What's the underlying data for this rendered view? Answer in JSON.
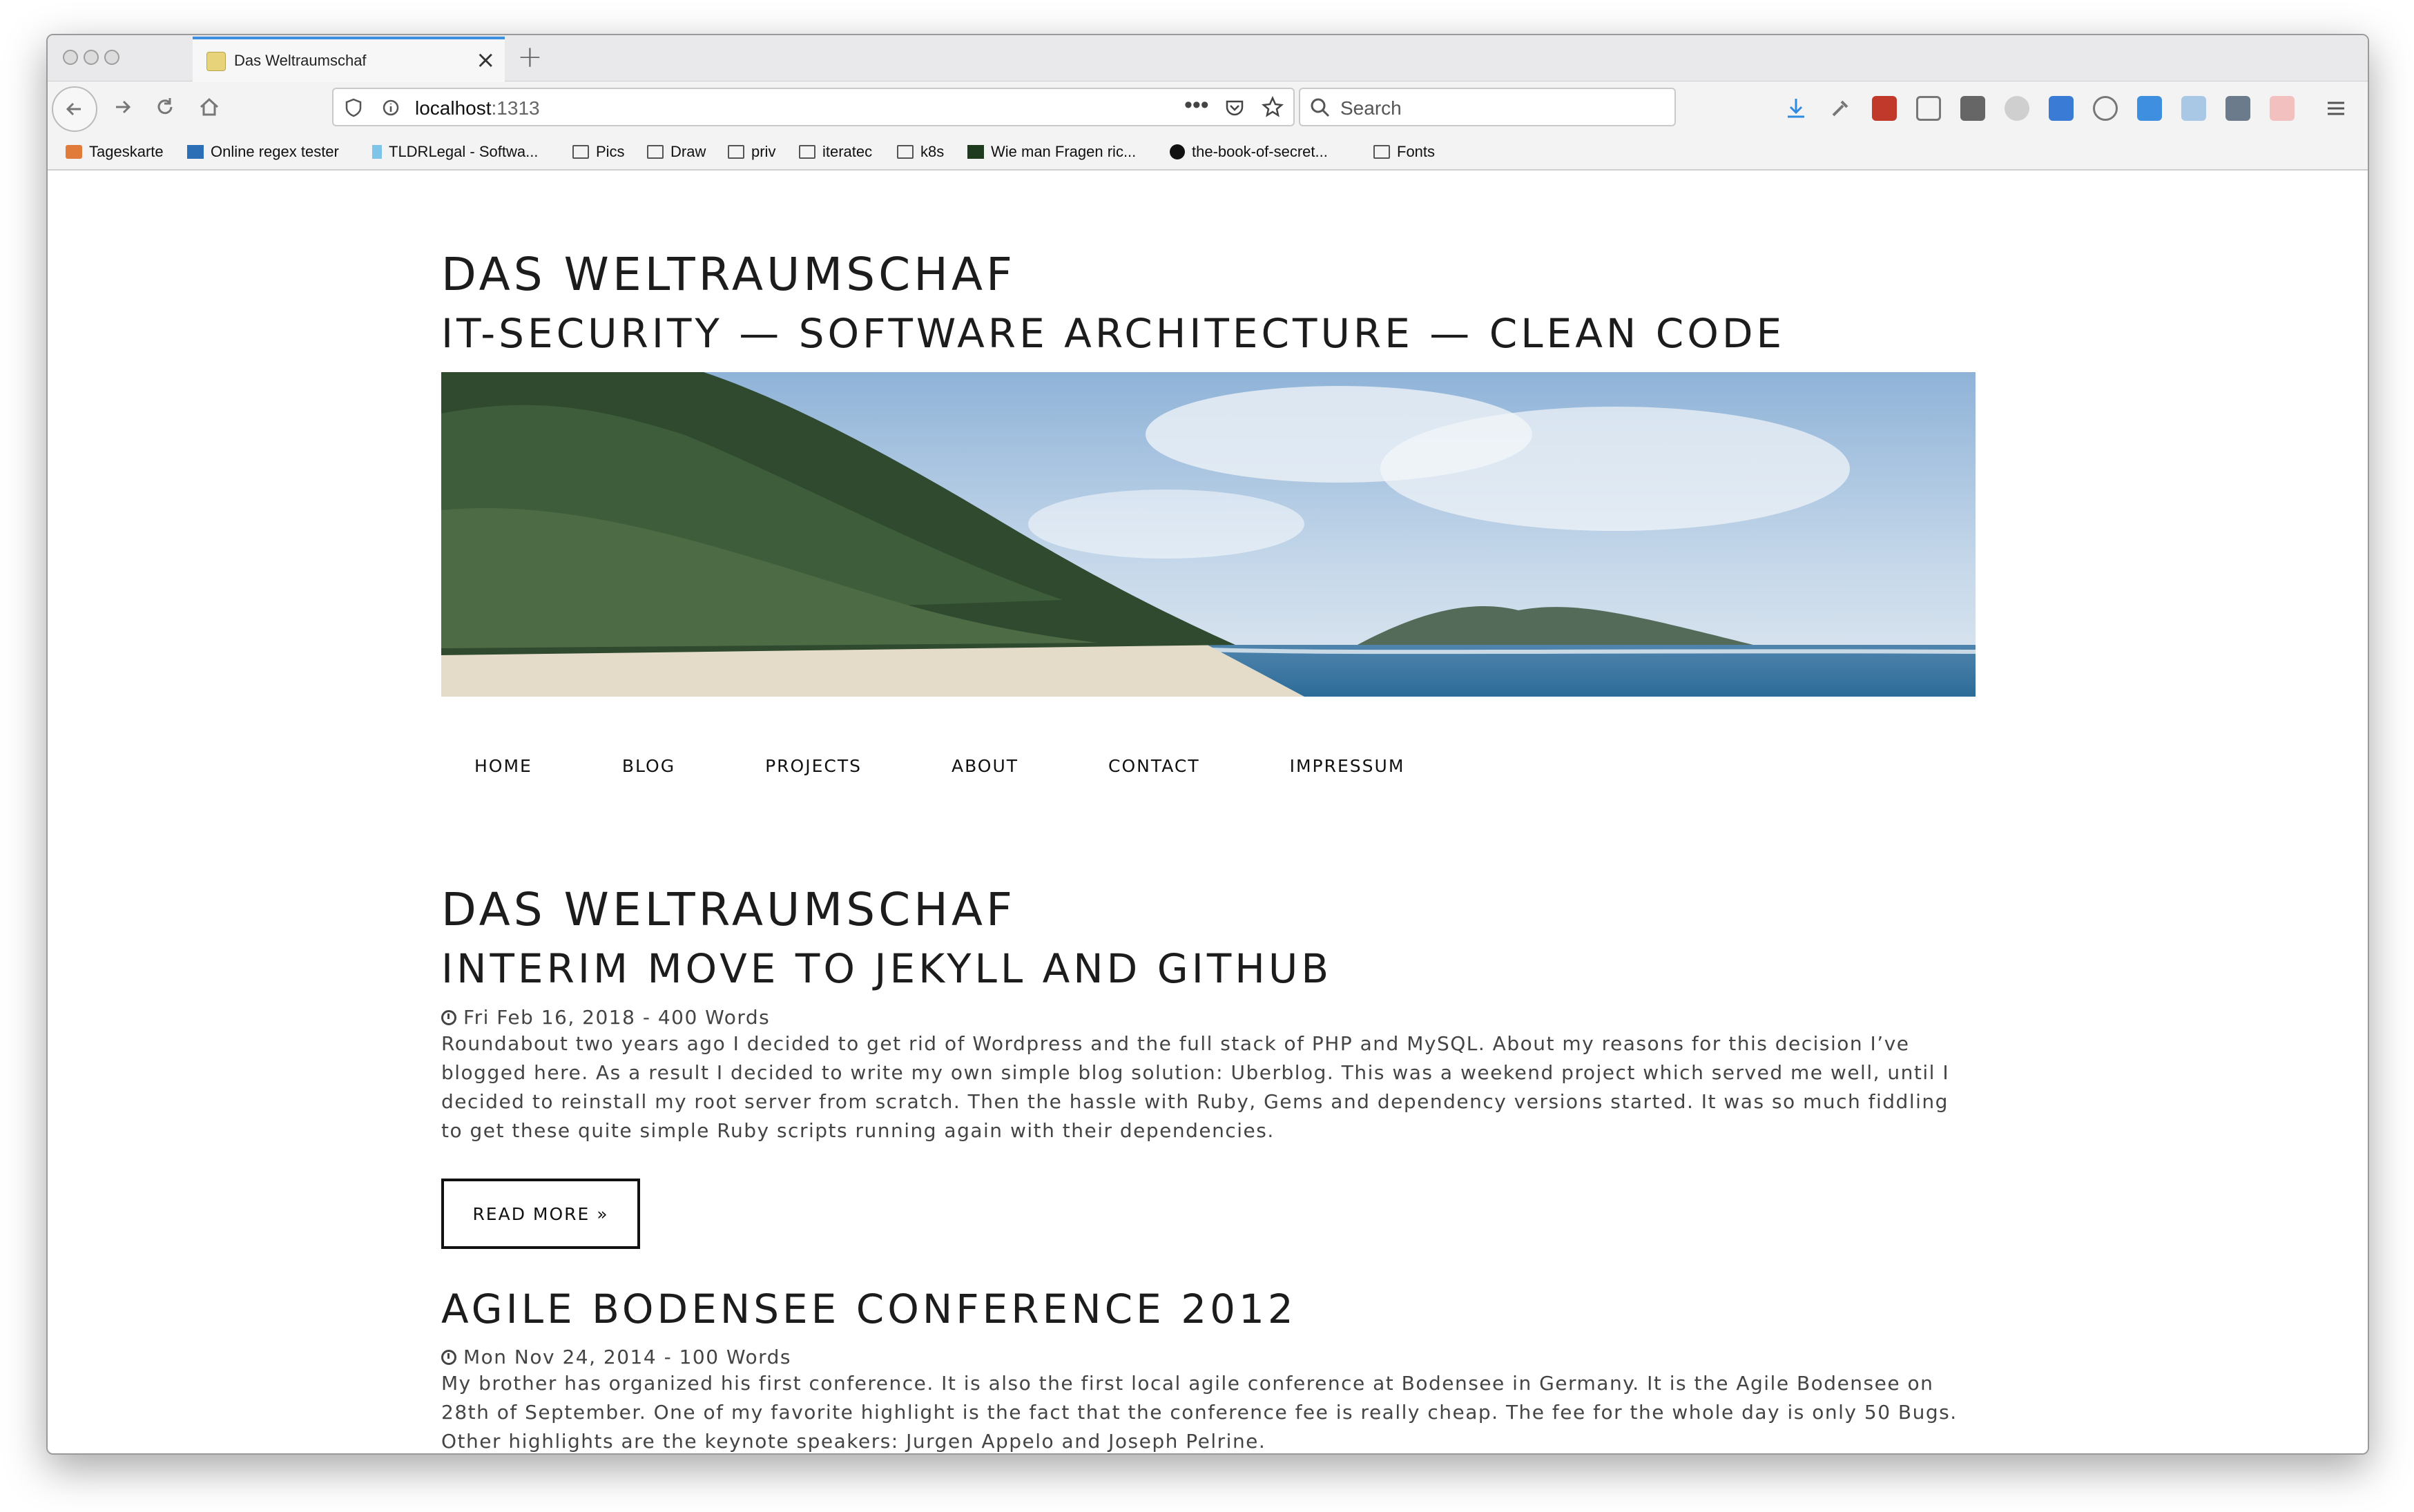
{
  "browser": {
    "tab_title": "Das Weltraumschaf",
    "url_host": "localhost",
    "url_port": ":1313",
    "search_placeholder": "Search",
    "bookmarks": [
      {
        "label": "Tageskarte",
        "icon": "tageskarte-icon"
      },
      {
        "label": "Online regex tester",
        "icon": "regex-icon"
      },
      {
        "label": "TLDRLegal - Softwa...",
        "icon": "tldrlegal-icon"
      },
      {
        "label": "Pics",
        "icon": "folder-icon"
      },
      {
        "label": "Draw",
        "icon": "folder-icon"
      },
      {
        "label": "priv",
        "icon": "folder-icon"
      },
      {
        "label": "iteratec",
        "icon": "folder-icon"
      },
      {
        "label": "k8s",
        "icon": "folder-icon"
      },
      {
        "label": "Wie man Fragen ric...",
        "icon": "terminal-icon"
      },
      {
        "label": "the-book-of-secret...",
        "icon": "github-icon"
      },
      {
        "label": "Fonts",
        "icon": "folder-icon"
      }
    ]
  },
  "site": {
    "title": "DAS WELTRAUMSCHAF",
    "subtitle": "IT-SECURITY — SOFTWARE ARCHITECTURE — CLEAN CODE",
    "menu": [
      "HOME",
      "BLOG",
      "PROJECTS",
      "ABOUT",
      "CONTACT",
      "IMPRESSUM"
    ]
  },
  "main": {
    "heading": "DAS WELTRAUMSCHAF",
    "posts": [
      {
        "title": "INTERIM MOVE TO JEKYLL AND GITHUB",
        "meta": "Fri Feb 16, 2018 - 400 Words",
        "excerpt": "Roundabout two years ago I decided to get rid of Wordpress and the full stack of PHP and MySQL. About my reasons for this decision I’ve blogged here. As a result I decided to write my own simple blog solution: Uberblog. This was a weekend project which served me well, until I decided to reinstall my root server from scratch. Then the hassle with Ruby, Gems and dependency versions started. It was so much fiddling to get these quite simple Ruby scripts running again with their dependencies.",
        "read_more": "READ MORE »"
      },
      {
        "title": "AGILE BODENSEE CONFERENCE 2012",
        "meta": "Mon Nov 24, 2014 - 100 Words",
        "excerpt": "My brother has organized his first conference. It is also the first local agile conference at Bodensee in Germany. It is the Agile Bodensee on 28th of September. One of my favorite highlight is the fact that the conference fee is really cheap. The fee for the whole day is only 50 Bugs. Other highlights are the keynote speakers: Jurgen Appelo and Joseph Pelrine."
      }
    ]
  }
}
